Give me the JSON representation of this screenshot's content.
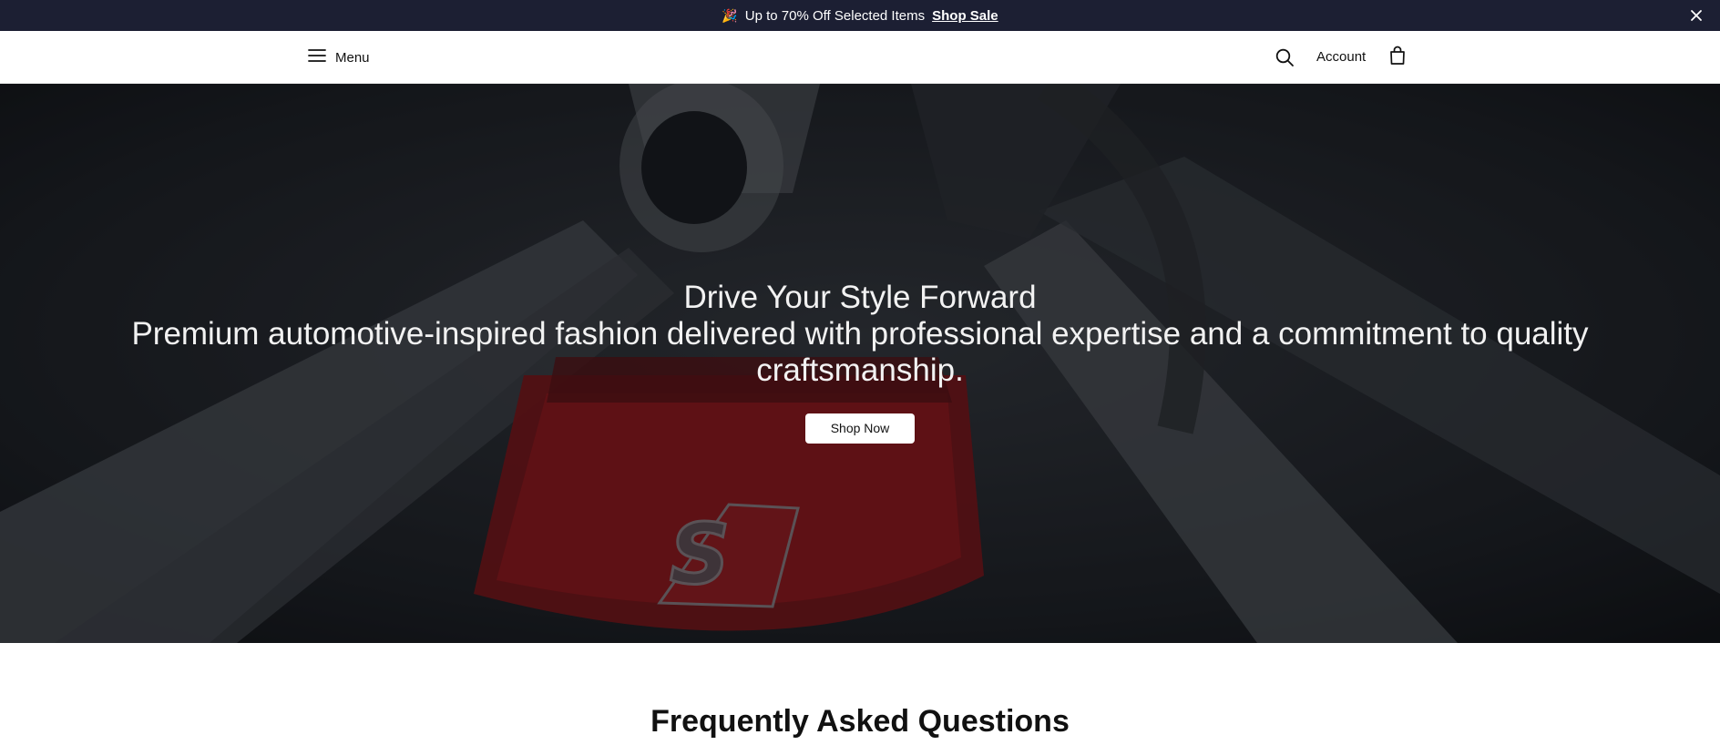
{
  "announcement": {
    "emoji": "🎉",
    "message": "Up to 70% Off Selected Items",
    "link_label": "Shop Sale"
  },
  "header": {
    "menu_label": "Menu",
    "account_label": "Account"
  },
  "hero": {
    "title": "Drive Your Style Forward",
    "subtitle": "Premium automotive-inspired fashion delivered with professional expertise and a commitment to quality craftsmanship.",
    "cta_label": "Shop Now",
    "badge_text": "S"
  },
  "faq": {
    "title": "Frequently Asked Questions"
  },
  "colors": {
    "announcement_bg": "#1c1f33",
    "brake_caliper": "#b0161c"
  },
  "icons": [
    "close-icon",
    "menu-icon",
    "search-icon",
    "bag-icon"
  ]
}
